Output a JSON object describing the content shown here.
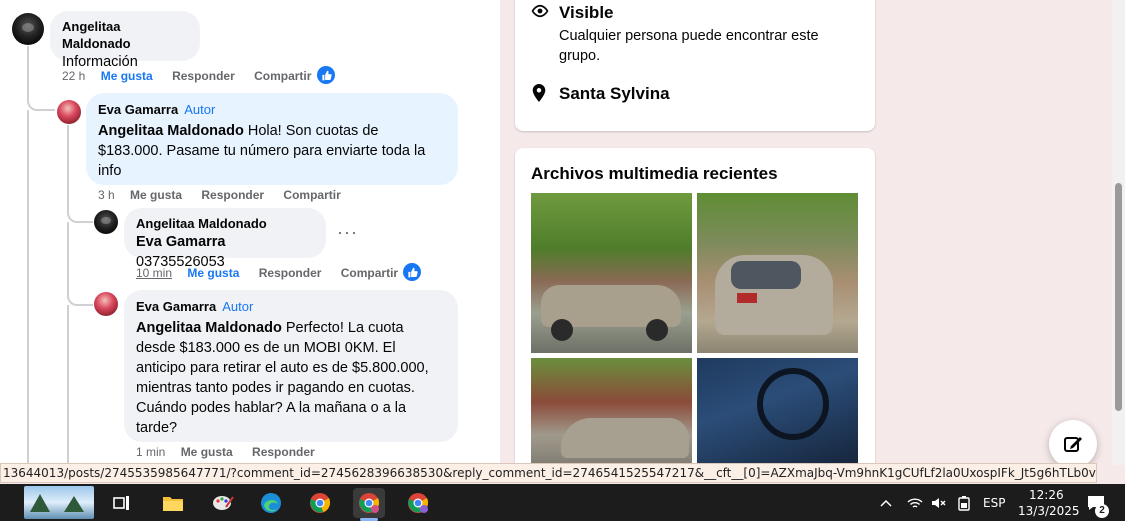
{
  "comments": [
    {
      "author": "Angelitaa Maldonado",
      "badge": "",
      "mention": "",
      "text": "Información",
      "time": "22 h",
      "like": "Me gusta",
      "reply": "Responder",
      "share": "Compartir",
      "liked": true
    },
    {
      "author": "Eva Gamarra",
      "badge": "Autor",
      "mention": "Angelitaa Maldonado",
      "text": " Hola! Son cuotas de $183.000. Pasame tu número para enviarte toda la info",
      "time": "3 h",
      "like": "Me gusta",
      "reply": "Responder",
      "share": "Compartir",
      "liked": false
    },
    {
      "author": "Angelitaa Maldonado",
      "badge": "",
      "mention": "Eva Gamarra",
      "text": " 03735526053",
      "time": "10 min",
      "like": "Me gusta",
      "reply": "Responder",
      "share": "Compartir",
      "liked": true
    },
    {
      "author": "Eva Gamarra",
      "badge": "Autor",
      "mention": "Angelitaa Maldonado",
      "text": " Perfecto! La cuota desde $183.000 es de un MOBI 0KM. El anticipo para retirar el auto es de $5.800.000, mientras tanto podes ir pagando en cuotas. Cuándo podes hablar? A la mañana o a la tarde?",
      "time": "1 min",
      "like": "Me gusta",
      "reply": "Responder",
      "share": "",
      "liked": false
    }
  ],
  "group_info": {
    "visibility_title": "Visible",
    "visibility_desc": "Cualquier persona puede encontrar este grupo.",
    "location": "Santa Sylvina"
  },
  "media": {
    "title": "Archivos multimedia recientes"
  },
  "status_url": "13644013/posts/2745535985647771/?comment_id=2745628396638530&reply_comment_id=2746541525547217&__cft__[0]=AZXmaJbq-Vm9hnK1gCUfLf2la0UxospIFk_Jt5g6hTLb0vwHTyU5Q28J0a2-6_griv...",
  "taskbar": {
    "language": "ESP",
    "time": "12:26",
    "date": "13/3/2025",
    "notifications": "2"
  },
  "colors": {
    "accent": "#1877f2",
    "bubble_gray": "#f0f2f5",
    "bubble_blue": "#e7f3ff",
    "taskbar": "#1c1c1c"
  }
}
